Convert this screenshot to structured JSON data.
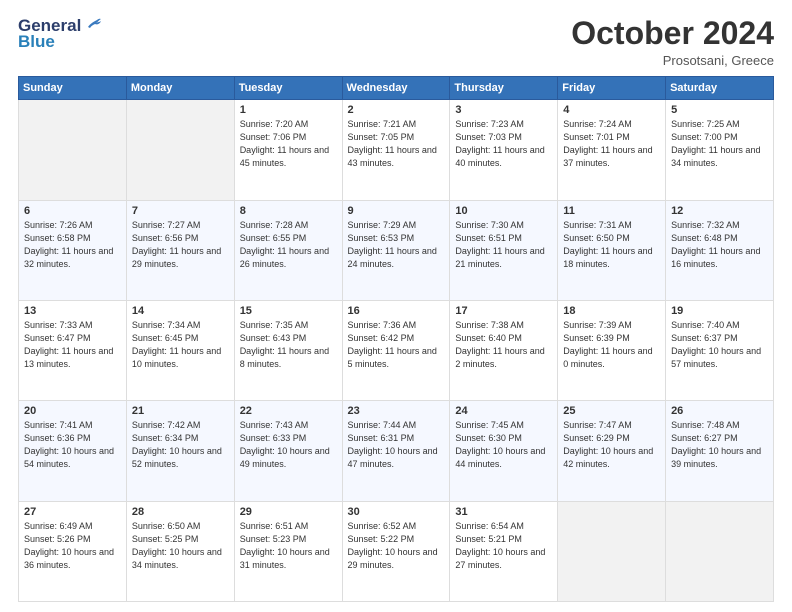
{
  "header": {
    "logo_general": "General",
    "logo_blue": "Blue",
    "month_title": "October 2024",
    "location": "Prosotsani, Greece"
  },
  "days_of_week": [
    "Sunday",
    "Monday",
    "Tuesday",
    "Wednesday",
    "Thursday",
    "Friday",
    "Saturday"
  ],
  "weeks": [
    [
      {
        "num": "",
        "info": ""
      },
      {
        "num": "",
        "info": ""
      },
      {
        "num": "1",
        "info": "Sunrise: 7:20 AM\nSunset: 7:06 PM\nDaylight: 11 hours and 45 minutes."
      },
      {
        "num": "2",
        "info": "Sunrise: 7:21 AM\nSunset: 7:05 PM\nDaylight: 11 hours and 43 minutes."
      },
      {
        "num": "3",
        "info": "Sunrise: 7:23 AM\nSunset: 7:03 PM\nDaylight: 11 hours and 40 minutes."
      },
      {
        "num": "4",
        "info": "Sunrise: 7:24 AM\nSunset: 7:01 PM\nDaylight: 11 hours and 37 minutes."
      },
      {
        "num": "5",
        "info": "Sunrise: 7:25 AM\nSunset: 7:00 PM\nDaylight: 11 hours and 34 minutes."
      }
    ],
    [
      {
        "num": "6",
        "info": "Sunrise: 7:26 AM\nSunset: 6:58 PM\nDaylight: 11 hours and 32 minutes."
      },
      {
        "num": "7",
        "info": "Sunrise: 7:27 AM\nSunset: 6:56 PM\nDaylight: 11 hours and 29 minutes."
      },
      {
        "num": "8",
        "info": "Sunrise: 7:28 AM\nSunset: 6:55 PM\nDaylight: 11 hours and 26 minutes."
      },
      {
        "num": "9",
        "info": "Sunrise: 7:29 AM\nSunset: 6:53 PM\nDaylight: 11 hours and 24 minutes."
      },
      {
        "num": "10",
        "info": "Sunrise: 7:30 AM\nSunset: 6:51 PM\nDaylight: 11 hours and 21 minutes."
      },
      {
        "num": "11",
        "info": "Sunrise: 7:31 AM\nSunset: 6:50 PM\nDaylight: 11 hours and 18 minutes."
      },
      {
        "num": "12",
        "info": "Sunrise: 7:32 AM\nSunset: 6:48 PM\nDaylight: 11 hours and 16 minutes."
      }
    ],
    [
      {
        "num": "13",
        "info": "Sunrise: 7:33 AM\nSunset: 6:47 PM\nDaylight: 11 hours and 13 minutes."
      },
      {
        "num": "14",
        "info": "Sunrise: 7:34 AM\nSunset: 6:45 PM\nDaylight: 11 hours and 10 minutes."
      },
      {
        "num": "15",
        "info": "Sunrise: 7:35 AM\nSunset: 6:43 PM\nDaylight: 11 hours and 8 minutes."
      },
      {
        "num": "16",
        "info": "Sunrise: 7:36 AM\nSunset: 6:42 PM\nDaylight: 11 hours and 5 minutes."
      },
      {
        "num": "17",
        "info": "Sunrise: 7:38 AM\nSunset: 6:40 PM\nDaylight: 11 hours and 2 minutes."
      },
      {
        "num": "18",
        "info": "Sunrise: 7:39 AM\nSunset: 6:39 PM\nDaylight: 11 hours and 0 minutes."
      },
      {
        "num": "19",
        "info": "Sunrise: 7:40 AM\nSunset: 6:37 PM\nDaylight: 10 hours and 57 minutes."
      }
    ],
    [
      {
        "num": "20",
        "info": "Sunrise: 7:41 AM\nSunset: 6:36 PM\nDaylight: 10 hours and 54 minutes."
      },
      {
        "num": "21",
        "info": "Sunrise: 7:42 AM\nSunset: 6:34 PM\nDaylight: 10 hours and 52 minutes."
      },
      {
        "num": "22",
        "info": "Sunrise: 7:43 AM\nSunset: 6:33 PM\nDaylight: 10 hours and 49 minutes."
      },
      {
        "num": "23",
        "info": "Sunrise: 7:44 AM\nSunset: 6:31 PM\nDaylight: 10 hours and 47 minutes."
      },
      {
        "num": "24",
        "info": "Sunrise: 7:45 AM\nSunset: 6:30 PM\nDaylight: 10 hours and 44 minutes."
      },
      {
        "num": "25",
        "info": "Sunrise: 7:47 AM\nSunset: 6:29 PM\nDaylight: 10 hours and 42 minutes."
      },
      {
        "num": "26",
        "info": "Sunrise: 7:48 AM\nSunset: 6:27 PM\nDaylight: 10 hours and 39 minutes."
      }
    ],
    [
      {
        "num": "27",
        "info": "Sunrise: 6:49 AM\nSunset: 5:26 PM\nDaylight: 10 hours and 36 minutes."
      },
      {
        "num": "28",
        "info": "Sunrise: 6:50 AM\nSunset: 5:25 PM\nDaylight: 10 hours and 34 minutes."
      },
      {
        "num": "29",
        "info": "Sunrise: 6:51 AM\nSunset: 5:23 PM\nDaylight: 10 hours and 31 minutes."
      },
      {
        "num": "30",
        "info": "Sunrise: 6:52 AM\nSunset: 5:22 PM\nDaylight: 10 hours and 29 minutes."
      },
      {
        "num": "31",
        "info": "Sunrise: 6:54 AM\nSunset: 5:21 PM\nDaylight: 10 hours and 27 minutes."
      },
      {
        "num": "",
        "info": ""
      },
      {
        "num": "",
        "info": ""
      }
    ]
  ]
}
